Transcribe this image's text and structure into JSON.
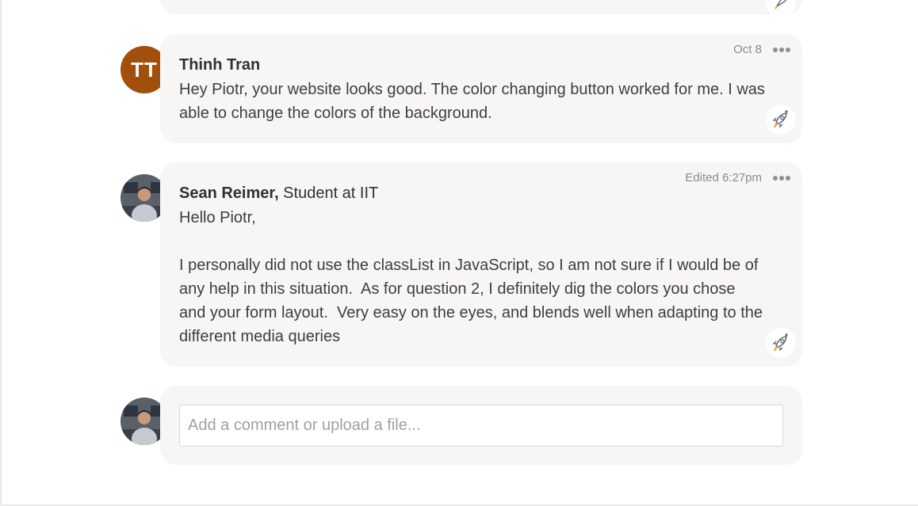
{
  "comments": [
    {
      "author": "Thinh Tran",
      "initials": "TT",
      "avatar_color": "#a14f0b",
      "timestamp": "Oct 8",
      "body": "Hey Piotr, your website looks good. The color changing button worked for me. I was able to change the colors of the background."
    },
    {
      "author": "Sean Reimer,",
      "role": " Student at IIT",
      "timestamp": "Edited 6:27pm",
      "body": "Hello Piotr,\n\nI personally did not use the classList in JavaScript, so I am not sure if I would be of any help in this situation.  As for question 2, I definitely dig the colors you chose and your form layout.  Very easy on the eyes, and blends well when adapting to the different media queries"
    }
  ],
  "compose": {
    "placeholder": "Add a comment or upload a file..."
  },
  "icons": {
    "more": "more-horizontal-icon",
    "reaction": "rocket-icon"
  }
}
